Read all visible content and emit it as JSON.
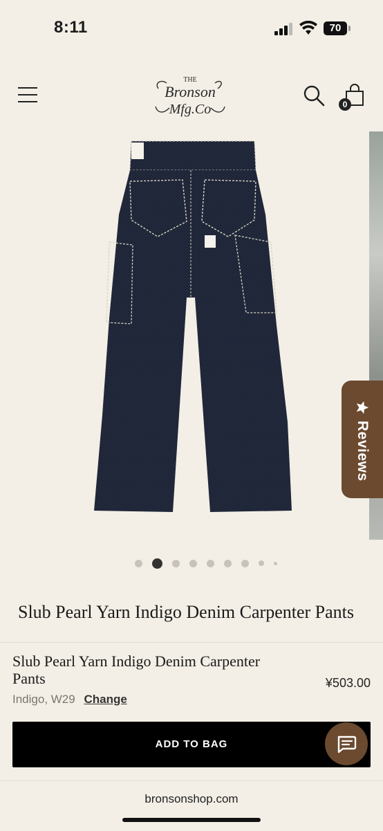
{
  "status_bar": {
    "time": "8:11",
    "battery": "70"
  },
  "header": {
    "logo_alt": "The Bronson Mfg. Co",
    "cart_count": "0"
  },
  "gallery": {
    "image_count": 9,
    "active_index": 1
  },
  "reviews_tab": {
    "label": "Reviews"
  },
  "product": {
    "title": "Slub Pearl Yarn Indigo Denim Carpenter Pants"
  },
  "sticky_bar": {
    "title": "Slub Pearl Yarn Indigo Denim Carpenter Pants",
    "variant": "Indigo, W29",
    "change_label": "Change",
    "price": "¥503.00",
    "add_to_bag_label": "ADD TO BAG"
  },
  "browser": {
    "url": "bronsonshop.com"
  },
  "colors": {
    "background": "#f3efe6",
    "accent": "#6b4a2f",
    "button": "#000000"
  }
}
